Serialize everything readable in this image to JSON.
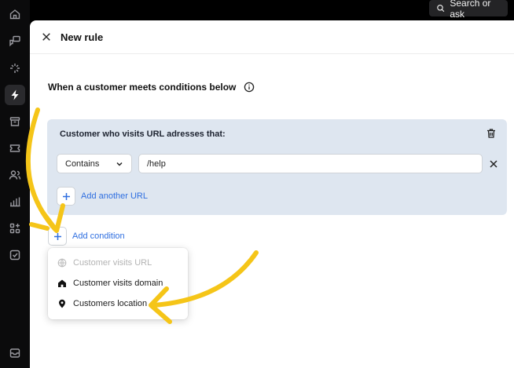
{
  "topbar": {
    "search_label": "Search or ask"
  },
  "rail": {
    "items": [
      "home-icon",
      "chat-icon",
      "sparkle-icon",
      "bolt-icon",
      "archive-icon",
      "ticket-icon",
      "users-icon",
      "chart-icon",
      "apps-icon",
      "check-icon",
      "inbox-icon"
    ],
    "active": "bolt-icon"
  },
  "panel": {
    "title": "New rule",
    "conditions_heading": "When a customer meets conditions below",
    "url_card": {
      "title": "Customer who visits URL adresses that:",
      "match_type": "Contains",
      "url_value": "/help",
      "add_url_label": "Add another URL"
    },
    "add_condition_label": "Add condition",
    "dropdown": {
      "items": [
        {
          "label": "Customer visits URL",
          "icon": "globe-icon",
          "disabled": true
        },
        {
          "label": "Customer visits domain",
          "icon": "house-icon",
          "disabled": false
        },
        {
          "label": "Customers location",
          "icon": "location-pin-icon",
          "disabled": false
        }
      ]
    }
  },
  "colors": {
    "accent_link": "#2f6fe0",
    "card_bg": "#dee6f0",
    "annotation": "#f5c518"
  }
}
